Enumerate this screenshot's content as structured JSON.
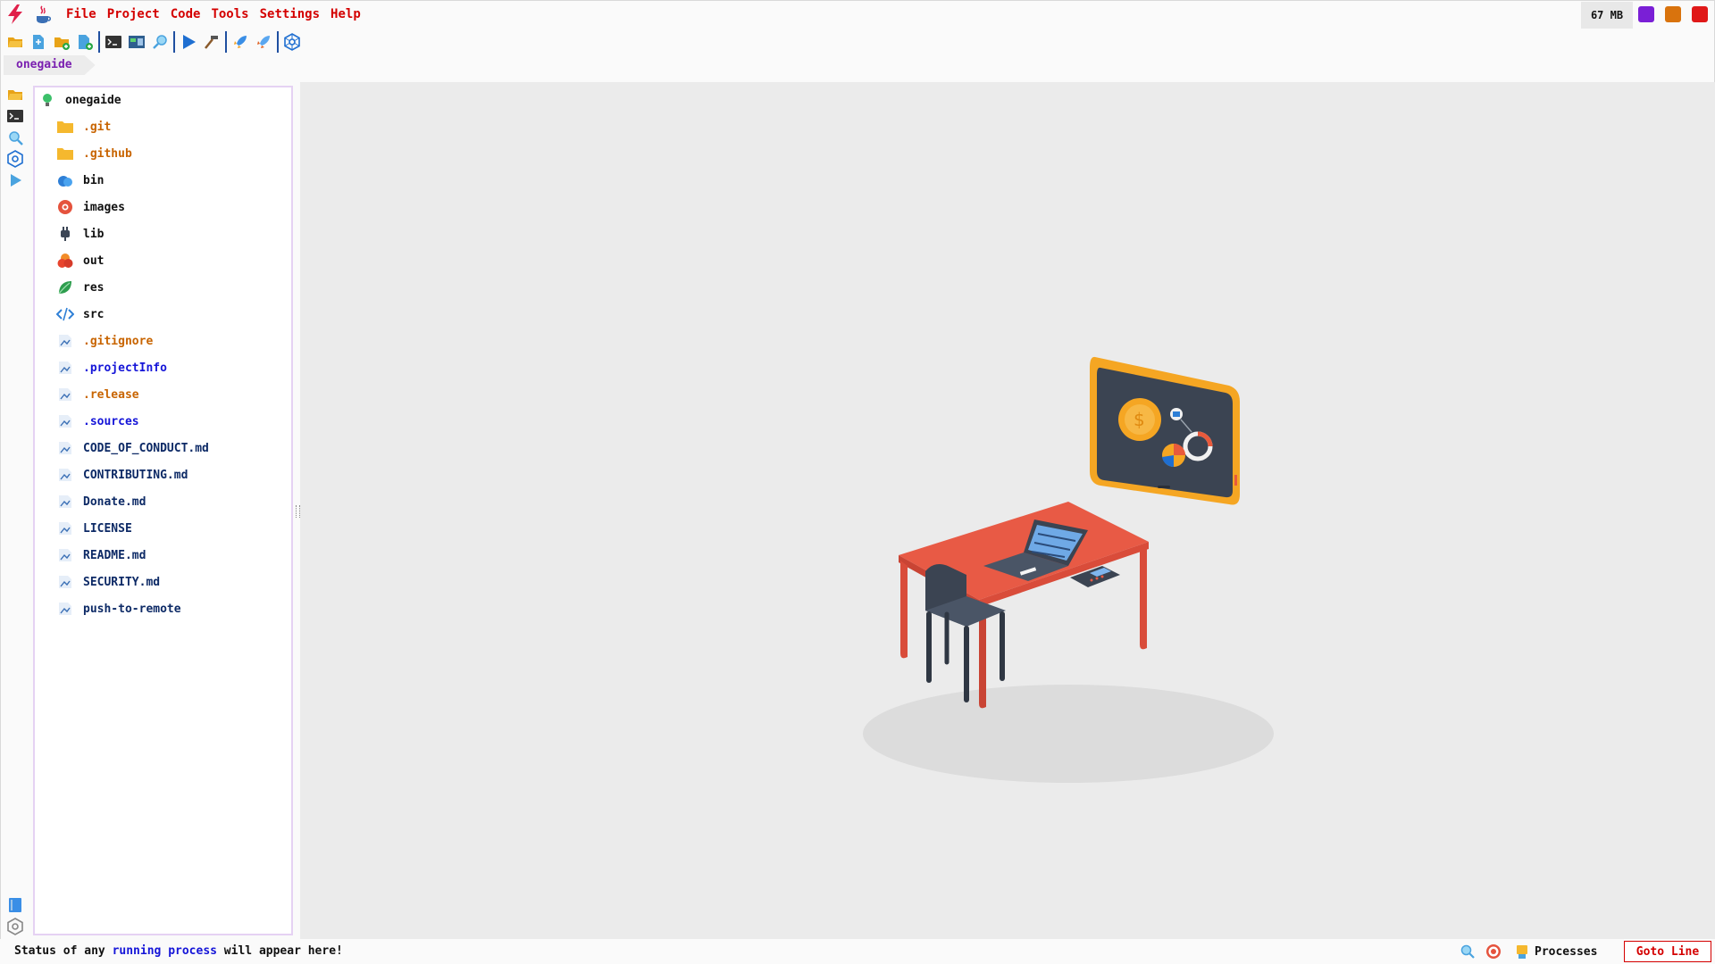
{
  "menu": {
    "items": [
      {
        "label": "File"
      },
      {
        "label": "Project"
      },
      {
        "label": "Code"
      },
      {
        "label": "Tools"
      },
      {
        "label": "Settings"
      },
      {
        "label": "Help"
      }
    ]
  },
  "memory": {
    "label": "67 MB"
  },
  "window_buttons": {
    "colors": [
      "#7a1fd6",
      "#d9730d",
      "#e01818"
    ]
  },
  "breadcrumb": {
    "label": "onegaide"
  },
  "tree": {
    "root": {
      "label": "onegaide",
      "icon": "lightbulb-icon"
    },
    "items": [
      {
        "label": ".git",
        "color": "#c86400",
        "icon": "folder-icon"
      },
      {
        "label": ".github",
        "color": "#c86400",
        "icon": "folder-icon"
      },
      {
        "label": "bin",
        "color": "#111111",
        "icon": "cloud-icon"
      },
      {
        "label": "images",
        "color": "#111111",
        "icon": "camera-icon"
      },
      {
        "label": "lib",
        "color": "#111111",
        "icon": "plug-icon"
      },
      {
        "label": "out",
        "color": "#111111",
        "icon": "boxes-icon"
      },
      {
        "label": "res",
        "color": "#111111",
        "icon": "leaf-icon"
      },
      {
        "label": "src",
        "color": "#111111",
        "icon": "code-icon"
      },
      {
        "label": ".gitignore",
        "color": "#c86400",
        "icon": "file-icon"
      },
      {
        "label": ".projectInfo",
        "color": "#1515d8",
        "icon": "file-icon"
      },
      {
        "label": ".release",
        "color": "#c86400",
        "icon": "file-icon"
      },
      {
        "label": ".sources",
        "color": "#1515d8",
        "icon": "file-icon"
      },
      {
        "label": "CODE_OF_CONDUCT.md",
        "color": "#0d2a66",
        "icon": "file-icon"
      },
      {
        "label": "CONTRIBUTING.md",
        "color": "#0d2a66",
        "icon": "file-icon"
      },
      {
        "label": "Donate.md",
        "color": "#0d2a66",
        "icon": "file-icon"
      },
      {
        "label": "LICENSE",
        "color": "#0d2a66",
        "icon": "file-icon"
      },
      {
        "label": "README.md",
        "color": "#0d2a66",
        "icon": "file-icon"
      },
      {
        "label": "SECURITY.md",
        "color": "#0d2a66",
        "icon": "file-icon"
      },
      {
        "label": "push-to-remote",
        "color": "#0d2a66",
        "icon": "file-icon"
      }
    ]
  },
  "status": {
    "part1": "Status of any ",
    "highlight": "running process",
    "part2": " will appear here!",
    "processes_label": "Processes",
    "goto_label": "Goto Line"
  },
  "colors": {
    "menu": "#d40000",
    "accent_purple": "#7a1fb0",
    "highlight_blue": "#1515d8"
  }
}
